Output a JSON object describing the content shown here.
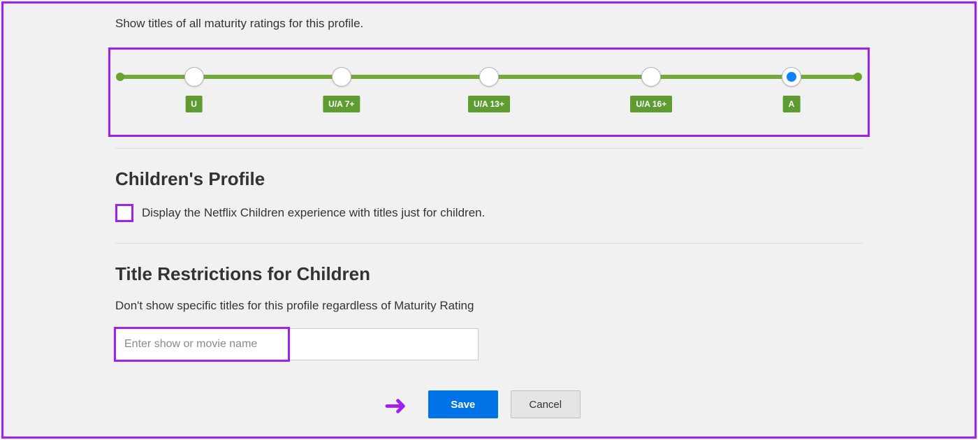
{
  "maturity": {
    "instruction": "Show titles of all maturity ratings for this profile.",
    "ticks": [
      {
        "label": "U",
        "pos_pct": 10,
        "selected": false
      },
      {
        "label": "U/A 7+",
        "pos_pct": 30,
        "selected": false
      },
      {
        "label": "U/A 13+",
        "pos_pct": 50,
        "selected": false
      },
      {
        "label": "U/A 16+",
        "pos_pct": 72,
        "selected": false
      },
      {
        "label": "A",
        "pos_pct": 91,
        "selected": true
      }
    ]
  },
  "children_profile": {
    "title": "Children's Profile",
    "checkbox_label": "Display the Netflix Children experience with titles just for children.",
    "checked": false
  },
  "title_restrictions": {
    "title": "Title Restrictions for Children",
    "description": "Don't show specific titles for this profile regardless of Maturity Rating",
    "placeholder": "Enter show or movie name",
    "value": ""
  },
  "buttons": {
    "save": "Save",
    "cancel": "Cancel"
  },
  "annotations": {
    "arrow_icon": "➜",
    "highlight_color": "#a020f0",
    "accent_color": "#0073e6",
    "slider_color": "#5e9b30"
  }
}
